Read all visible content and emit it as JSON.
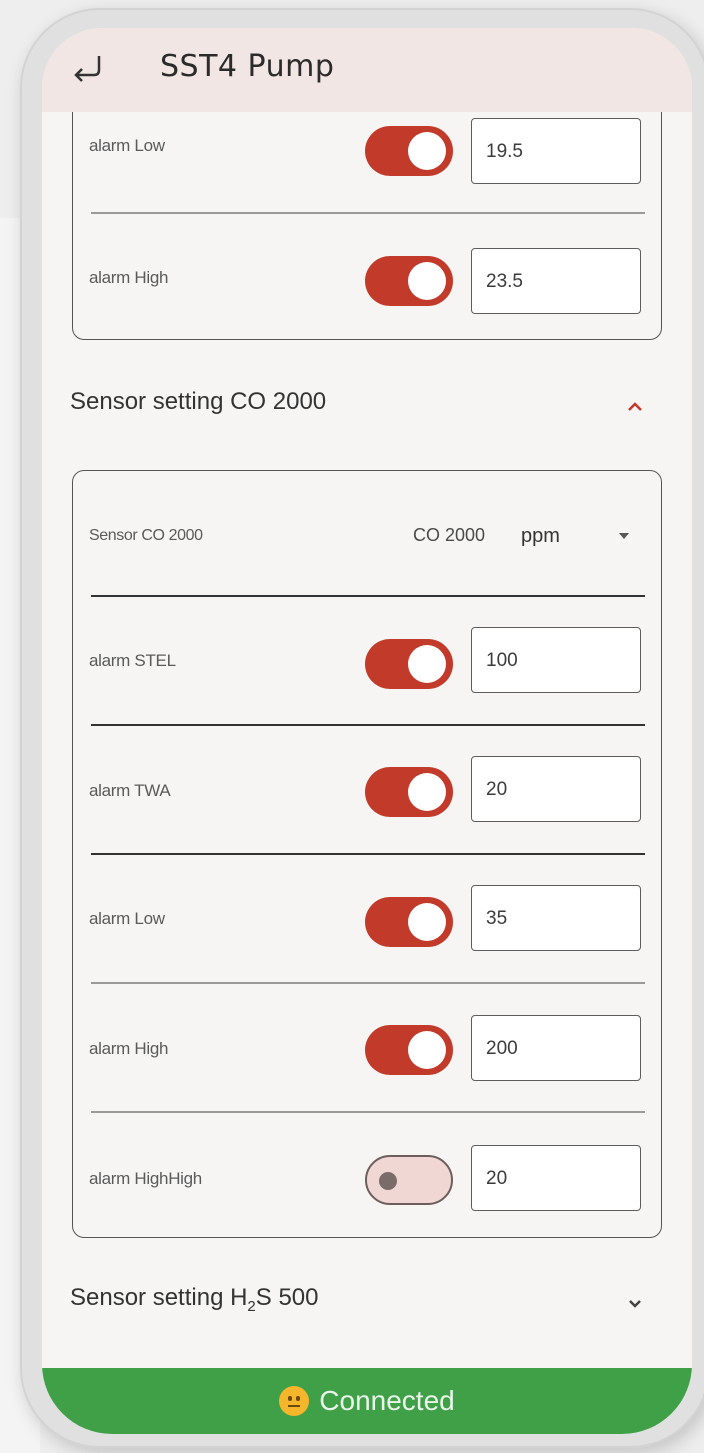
{
  "app_bar": {
    "title": "SST4 Pump",
    "back_icon": "return-arrow-icon"
  },
  "top_card": {
    "rows": [
      {
        "label": "alarm Low",
        "enabled": true,
        "value": "19.5"
      },
      {
        "label": "alarm High",
        "enabled": true,
        "value": "23.5"
      }
    ]
  },
  "sections": [
    {
      "title": "Sensor setting CO 2000",
      "expanded": true,
      "chevron": "chevron-up-icon"
    },
    {
      "title_prefix": "Sensor setting H",
      "title_sub": "2",
      "title_suffix": "S 500",
      "expanded": false,
      "chevron": "chevron-down-icon"
    }
  ],
  "co_card": {
    "sensor_label": "Sensor CO 2000",
    "sensor_value": "CO 2000",
    "sensor_unit": "ppm",
    "rows": [
      {
        "label": "alarm STEL",
        "enabled": true,
        "value": "100"
      },
      {
        "label": "alarm TWA",
        "enabled": true,
        "value": "20"
      },
      {
        "label": "alarm Low",
        "enabled": true,
        "value": "35"
      },
      {
        "label": "alarm High",
        "enabled": true,
        "value": "200"
      },
      {
        "label": "alarm HighHigh",
        "enabled": false,
        "value": "20"
      }
    ]
  },
  "status": {
    "text": "Connected",
    "icon": "neutral-face-emoji-icon",
    "color": "#3fa047"
  },
  "colors": {
    "toggle_on": "#c13a2a",
    "toggle_off": "#f0d7d3",
    "app_bar": "#f1e6e3"
  }
}
